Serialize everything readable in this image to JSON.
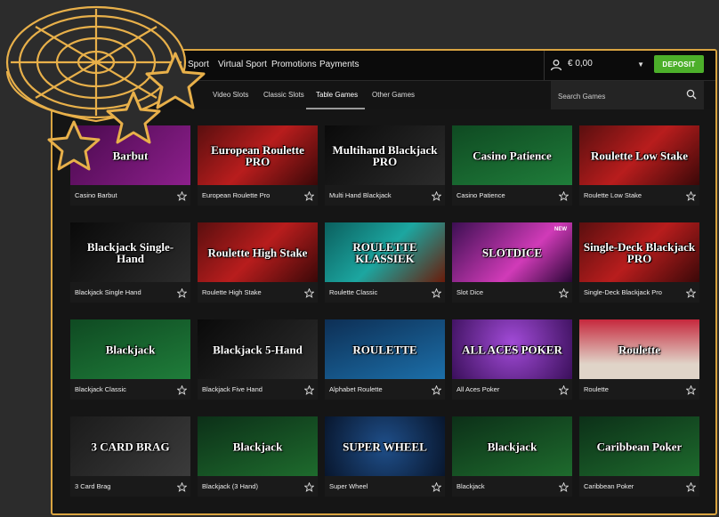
{
  "nav": [
    "Sport",
    "Virtual Sport",
    "Promotions",
    "Payments"
  ],
  "account": {
    "balance": "€ 0,00",
    "deposit_label": "DEPOSIT"
  },
  "subnav": [
    "Video Slots",
    "Classic Slots",
    "Table Games",
    "Other Games"
  ],
  "search": {
    "placeholder": "Search Games"
  },
  "games": [
    {
      "label": "Casino Barbut",
      "art": "Barbut"
    },
    {
      "label": "European Roulette Pro",
      "art": "European Roulette PRO"
    },
    {
      "label": "Multi Hand Blackjack",
      "art": "Multihand Blackjack PRO"
    },
    {
      "label": "Casino Patience",
      "art": "Casino Patience"
    },
    {
      "label": "Roulette Low Stake",
      "art": "Roulette Low Stake"
    },
    {
      "label": "Blackjack Single Hand",
      "art": "Blackjack Single-Hand"
    },
    {
      "label": "Roulette High Stake",
      "art": "Roulette High Stake"
    },
    {
      "label": "Roulette Classic",
      "art": "ROULETTE KLASSIEK"
    },
    {
      "label": "Slot Dice",
      "art": "SLOTDICE",
      "badge": "NEW"
    },
    {
      "label": "Single-Deck Blackjack Pro",
      "art": "Single-Deck Blackjack PRO"
    },
    {
      "label": "Blackjack Classic",
      "art": "Blackjack"
    },
    {
      "label": "Blackjack Five Hand",
      "art": "Blackjack 5-Hand"
    },
    {
      "label": "Alphabet Roulette",
      "art": "ROULETTE"
    },
    {
      "label": "All Aces Poker",
      "art": "ALL ACES POKER"
    },
    {
      "label": "Roulette",
      "art": "Roulette"
    },
    {
      "label": "3 Card Brag",
      "art": "3 CARD BRAG"
    },
    {
      "label": "Blackjack (3 Hand)",
      "art": "Blackjack"
    },
    {
      "label": "Super Wheel",
      "art": "SUPER WHEEL"
    },
    {
      "label": "Blackjack",
      "art": "Blackjack"
    },
    {
      "label": "Caribbean Poker",
      "art": "Caribbean Poker"
    }
  ],
  "colors": {
    "frame": "#d9a441",
    "deposit": "#4caf2a"
  }
}
